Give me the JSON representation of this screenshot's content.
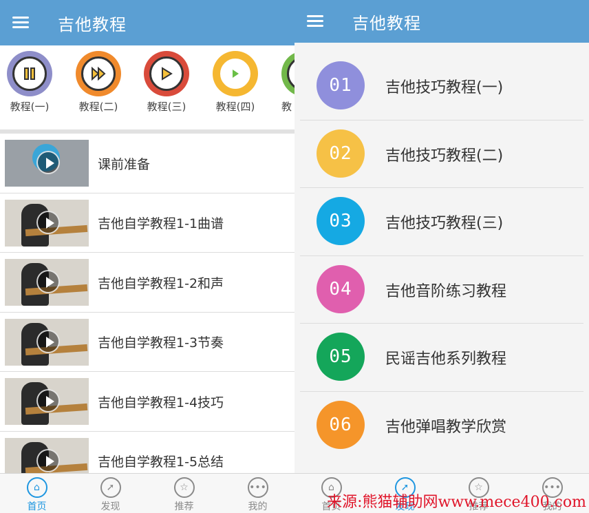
{
  "left": {
    "title": "吉他教程",
    "categories": [
      {
        "label": "教程(一)",
        "color": "#8e8ec9",
        "icon": "pause-icon"
      },
      {
        "label": "教程(二)",
        "color": "#f08a2c",
        "icon": "fast-forward-icon"
      },
      {
        "label": "教程(三)",
        "color": "#d94b3b",
        "icon": "play-icon"
      },
      {
        "label": "教程(四)",
        "color": "#f5b731",
        "icon": "play-icon"
      },
      {
        "label": "教",
        "color": "#72b84a",
        "icon": "play-icon"
      }
    ],
    "lessons": [
      "课前准备",
      "吉他自学教程1-1曲谱",
      "吉他自学教程1-2和声",
      "吉他自学教程1-3节奏",
      "吉他自学教程1-4技巧",
      "吉他自学教程1-5总结"
    ],
    "tabs": [
      "首页",
      "发现",
      "推荐",
      "我的"
    ]
  },
  "right": {
    "title": "吉他教程",
    "items": [
      {
        "num": "01",
        "label": "吉他技巧教程(一)",
        "color": "#8f8fdc"
      },
      {
        "num": "02",
        "label": "吉他技巧教程(二)",
        "color": "#f6c146"
      },
      {
        "num": "03",
        "label": "吉他技巧教程(三)",
        "color": "#15a9e3"
      },
      {
        "num": "04",
        "label": "吉他音阶练习教程",
        "color": "#e05fae"
      },
      {
        "num": "05",
        "label": "民谣吉他系列教程",
        "color": "#14a65a"
      },
      {
        "num": "06",
        "label": "吉他弹唱教学欣赏",
        "color": "#f5952a"
      }
    ],
    "tabs": [
      "首页",
      "发现",
      "推荐",
      "我的"
    ]
  },
  "watermark": "来源:熊猫辅助网www.mece400.com",
  "colors": {
    "accent": "#1e96e0",
    "topbar": "#5b9fd3"
  }
}
